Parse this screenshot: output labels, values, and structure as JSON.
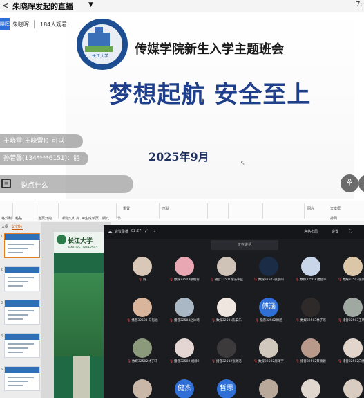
{
  "stream": {
    "back_glyph": "<",
    "title": "朱晓晖发起的直播",
    "caret": "▼",
    "corner_text": "7:",
    "host": {
      "avatar_text": "晓晖",
      "name": "朱晓晖",
      "viewers": "184人观看"
    },
    "slide": {
      "university_logo_text": "长江大学",
      "subtitle": "传媒学院新生入学主题班会",
      "main_title": "梦想起航 安全至上",
      "date": "2025年9月"
    },
    "comments": [
      {
        "text": "王晓雷(王晓雷)：可以"
      },
      {
        "text": "孙若馨(134****6151)：能"
      }
    ],
    "input_placeholder": "说点什么",
    "right_buttons": [
      "gift-icon",
      "share-icon"
    ]
  },
  "ppt": {
    "ribbon_groups": [
      {
        "label": "格式刷"
      },
      {
        "label": "粘贴"
      },
      {
        "label": "当页开始"
      },
      {
        "label": "新建幻灯片"
      },
      {
        "label": "AI生成单页"
      },
      {
        "label": "版式"
      },
      {
        "label": "节"
      },
      {
        "label": "重置"
      },
      {
        "label": "形状"
      },
      {
        "label": "图片"
      },
      {
        "label": "文本框"
      },
      {
        "label": "排列"
      }
    ],
    "pane_tabs": {
      "outline": "大纲",
      "slides": "幻灯片"
    },
    "thumb_numbers": [
      "1",
      "2",
      "3",
      "4",
      "5"
    ],
    "edit_slide": {
      "university": "长江大学",
      "english": "YANGTZE UNIVERSITY"
    }
  },
  "meeting": {
    "brand": "会议录播",
    "time": "02:27",
    "top_right": [
      "宫格布局",
      "设置"
    ],
    "search_text": "正在讲话",
    "participants": [
      {
        "name": "阿",
        "avatar": "photo",
        "color": "#d9c8b8"
      },
      {
        "name": "数媒32503张婉容",
        "avatar": "photo",
        "color": "#e8a7b2"
      },
      {
        "name": "播音32501涂浩宇豆",
        "avatar": "photo",
        "color": "#cfc2b6"
      },
      {
        "name": "数媒32503张晨阳",
        "avatar": "photo",
        "color": "#1a2c46"
      },
      {
        "name": "数媒32503 唐智韦",
        "avatar": "photo",
        "color": "#c9d6ea"
      },
      {
        "name": "数媒32502张新磊",
        "avatar": "photo",
        "color": "#dcc6a8"
      },
      {
        "name": "播音32503 马韬涵",
        "avatar": "photo",
        "color": "#d8b59b"
      },
      {
        "name": "播音32503赵沐瑶",
        "avatar": "photo",
        "color": "#aab7c4"
      },
      {
        "name": "数媒32501陈安乐",
        "avatar": "photo",
        "color": "#efe6e0"
      },
      {
        "name": "播音32502傅涵",
        "avatar": "text",
        "text": "傅涵",
        "color": "#2f6fd6"
      },
      {
        "name": "数媒32503林子瑶",
        "avatar": "photo",
        "color": "#2e2a2a"
      },
      {
        "name": "播音32503王晴宇",
        "avatar": "photo",
        "color": "#9fa9a1"
      },
      {
        "name": "数媒32502林子轩",
        "avatar": "photo",
        "color": "#8b9a7a"
      },
      {
        "name": "播音32502 胡静2",
        "avatar": "photo",
        "color": "#e4d6d2"
      },
      {
        "name": "播音32502张佩洁",
        "avatar": "photo",
        "color": "#3c3a3a"
      },
      {
        "name": "数媒32502周泽宇",
        "avatar": "photo",
        "color": "#d0c7bd"
      },
      {
        "name": "播音32502蔡颖颖",
        "avatar": "photo",
        "color": "#b99a8a"
      },
      {
        "name": "播音32502向博文",
        "avatar": "photo",
        "color": "#e2d5cc"
      },
      {
        "name": "",
        "avatar": "photo",
        "color": "#c9b8a8"
      },
      {
        "name": "",
        "avatar": "text",
        "text": "健杰",
        "color": "#2f6fd6"
      },
      {
        "name": "",
        "avatar": "text",
        "text": "哲思",
        "color": "#2f6fd6"
      },
      {
        "name": "",
        "avatar": "photo",
        "color": "#b9a99a"
      },
      {
        "name": "",
        "avatar": "photo",
        "color": "#e0d8cf"
      },
      {
        "name": "",
        "avatar": "photo",
        "color": "#d9ccc0"
      }
    ]
  }
}
